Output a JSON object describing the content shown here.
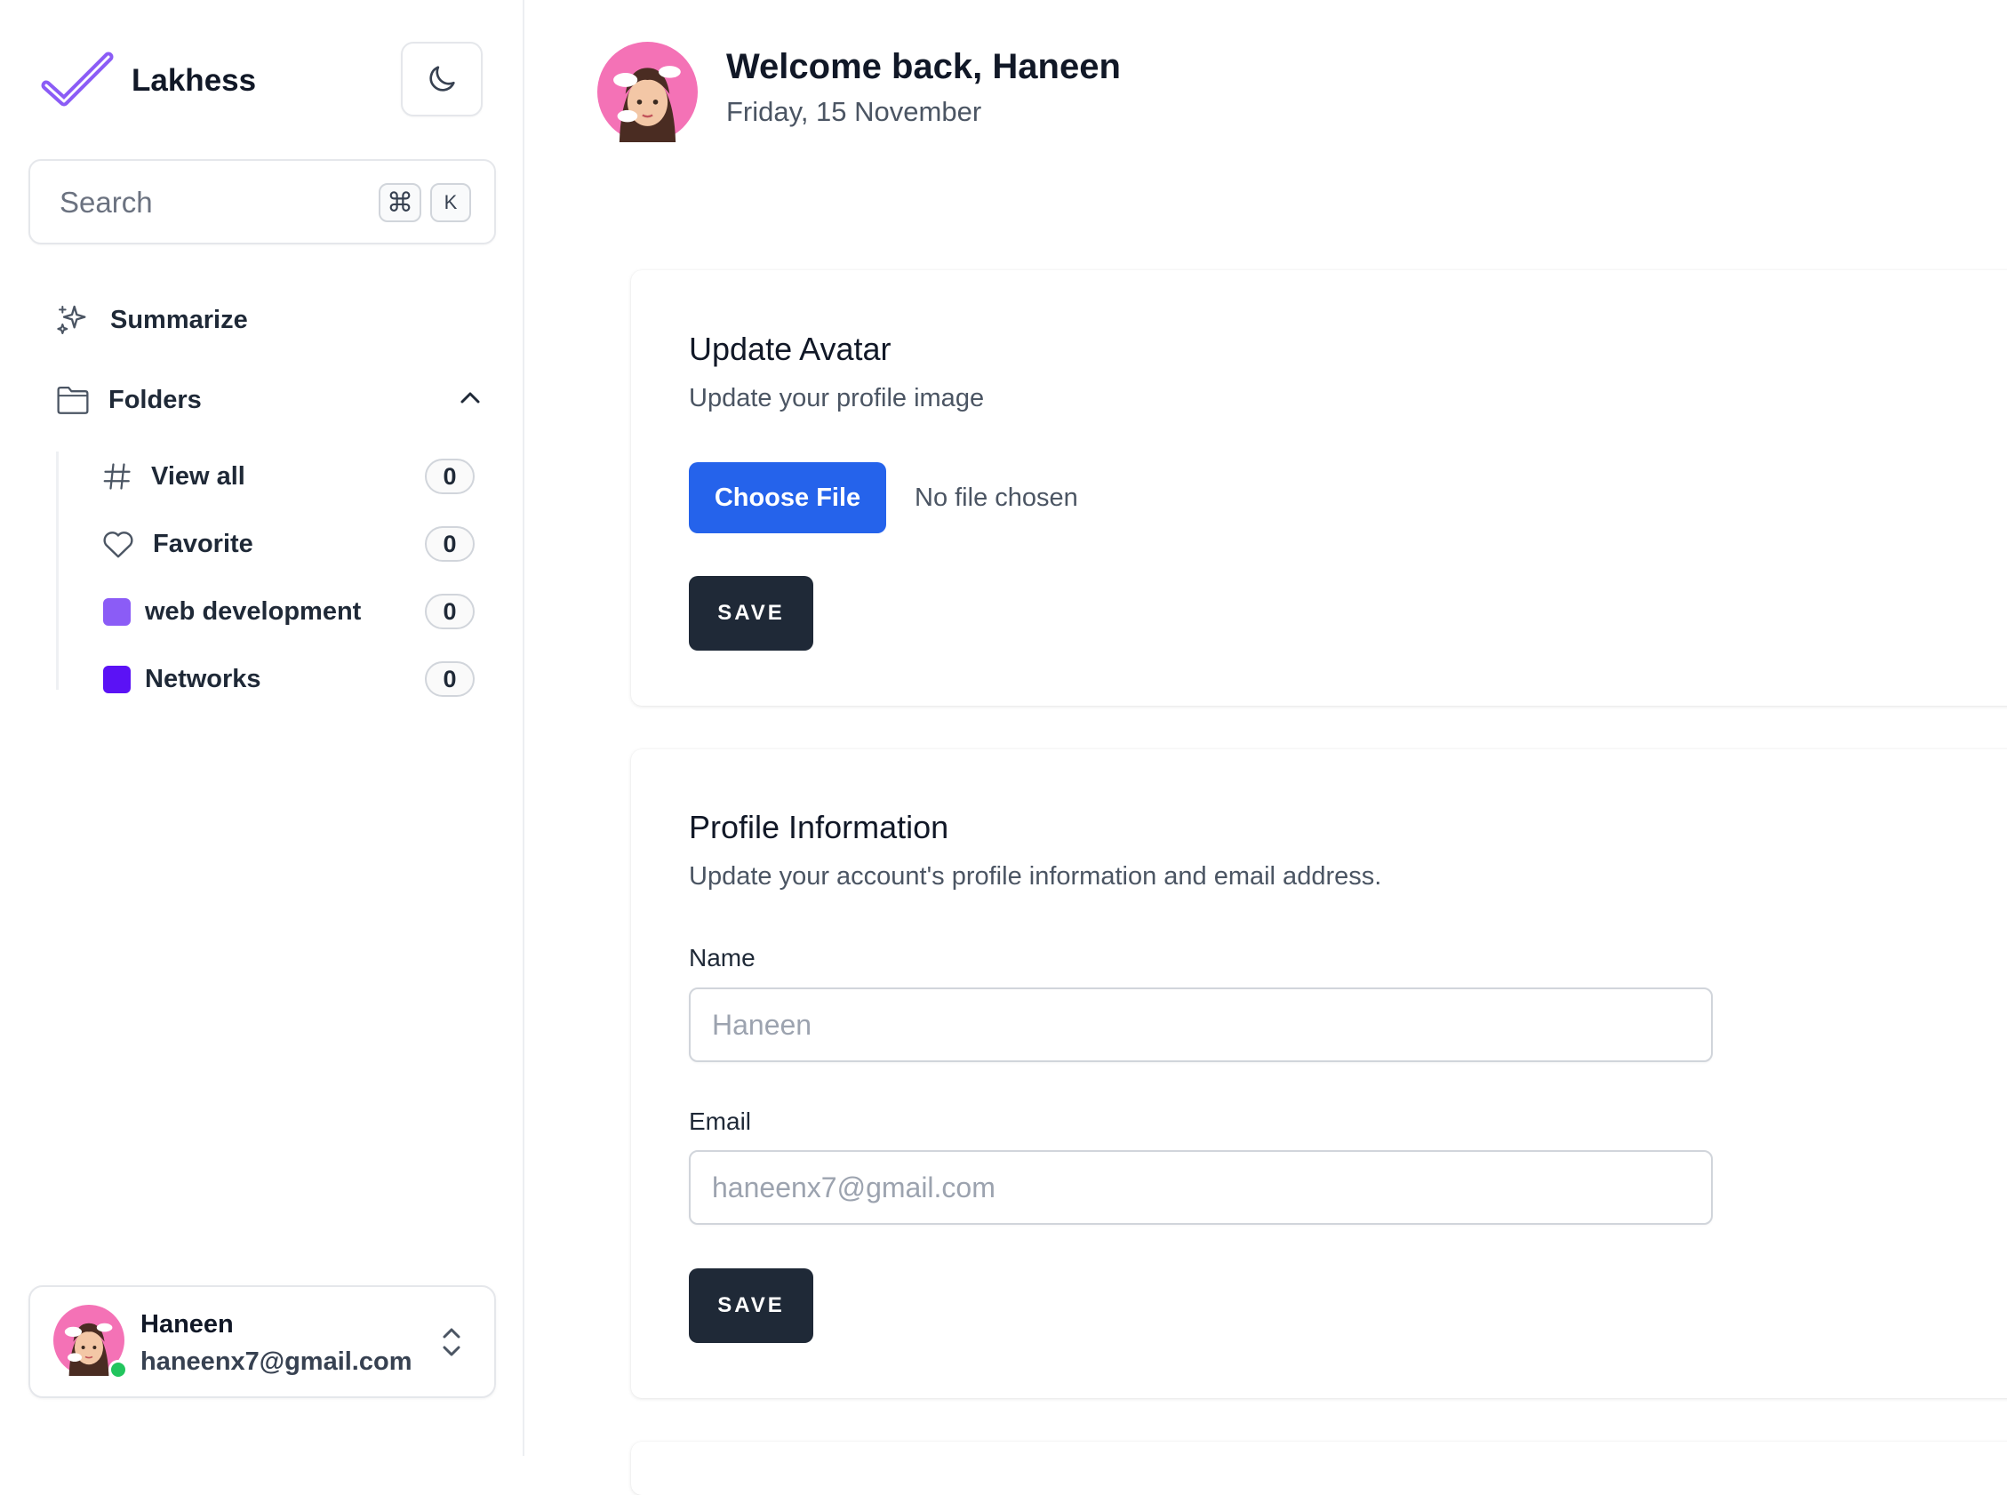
{
  "sidebar": {
    "app_name": "Lakhess",
    "search": {
      "placeholder": "Search",
      "shortcut_modifier": "⌘",
      "shortcut_key": "K"
    },
    "summarize_label": "Summarize",
    "folders_label": "Folders",
    "folders_expanded": true,
    "folder_items": [
      {
        "label": "View all",
        "count": "0",
        "icon": "hash-icon"
      },
      {
        "label": "Favorite",
        "count": "0",
        "icon": "heart-icon"
      },
      {
        "label": "web development",
        "count": "0",
        "color": "#8b5cf6"
      },
      {
        "label": "Networks",
        "count": "0",
        "color": "#5b12f5"
      }
    ],
    "user": {
      "name": "Haneen",
      "email": "haneenx7@gmail.com",
      "online": true
    }
  },
  "header": {
    "welcome": "Welcome back, Haneen",
    "date": "Friday, 15 November"
  },
  "avatar_section": {
    "title": "Update Avatar",
    "description": "Update your profile image",
    "choose_file_label": "Choose File",
    "file_status": "No file chosen",
    "save_label": "SAVE"
  },
  "profile_section": {
    "title": "Profile Information",
    "description": "Update your account's profile information and email address.",
    "name_label": "Name",
    "name_placeholder": "Haneen",
    "email_label": "Email",
    "email_placeholder": "haneenx7@gmail.com",
    "save_label": "SAVE"
  },
  "colors": {
    "brand": "#8b5cf6",
    "primary_button": "#2563eb",
    "dark_button": "#1f2937",
    "online": "#22c55e"
  }
}
